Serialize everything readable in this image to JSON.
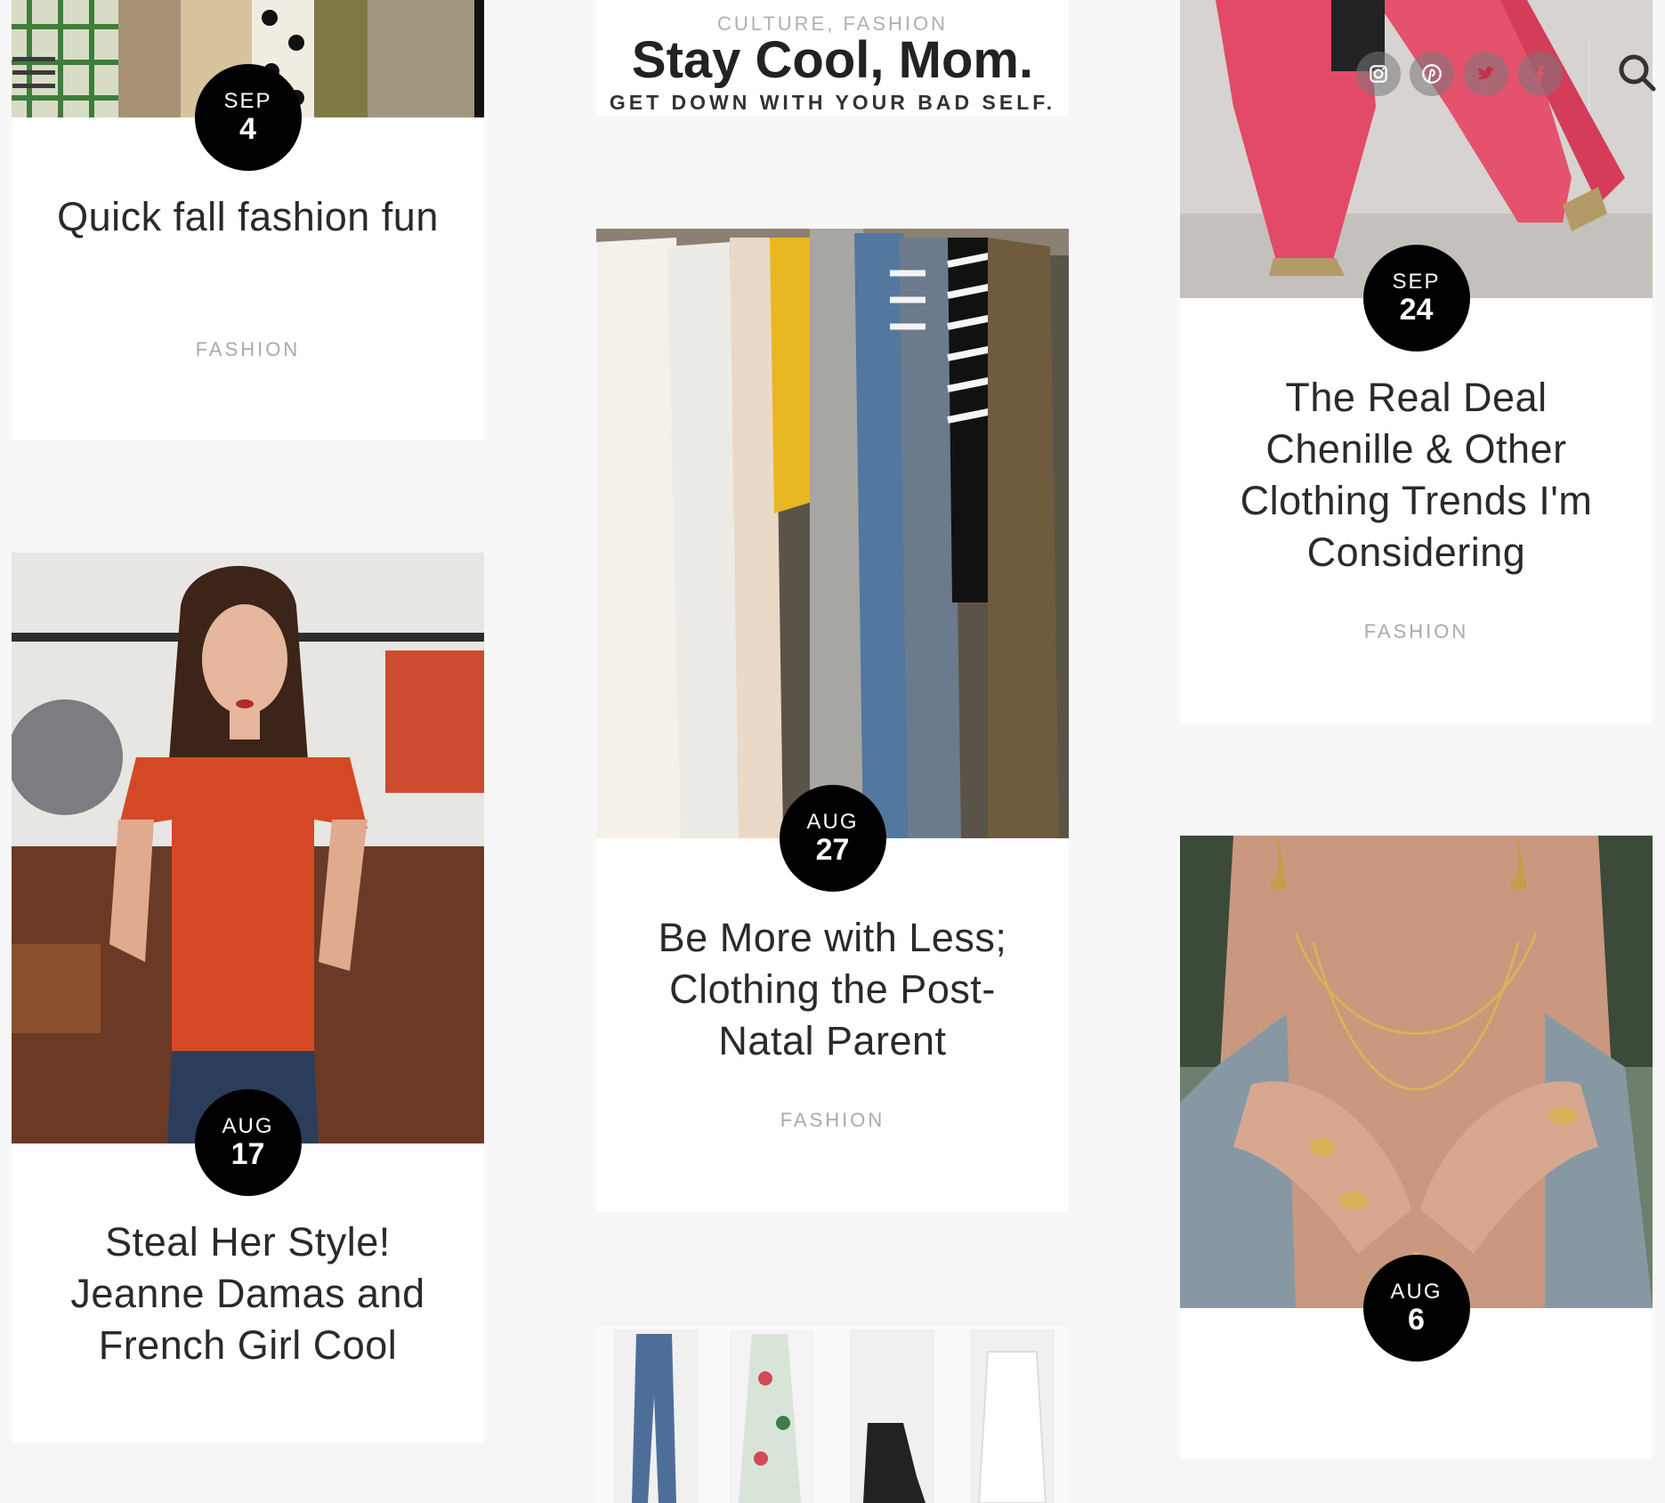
{
  "header": {
    "categories": "CULTURE, FASHION",
    "site_title": "Stay Cool, Mom.",
    "tagline": "GET DOWN WITH YOUR BAD SELF."
  },
  "social": [
    "instagram-icon",
    "pinterest-icon",
    "twitter-icon",
    "facebook-icon"
  ],
  "posts": [
    {
      "month": "SEP",
      "day": "4",
      "title": "Quick fall fashion fun",
      "category": "FASHION"
    },
    {
      "month": "SEP",
      "day": "24",
      "title": "The Real Deal Chenille & Other Clothing Trends I'm Considering",
      "category": "FASHION"
    },
    {
      "month": "AUG",
      "day": "27",
      "title": "Be More with Less; Clothing the Post-Natal Parent",
      "category": "FASHION"
    },
    {
      "month": "AUG",
      "day": "17",
      "title": "Steal Her Style! Jeanne Damas and French Girl Cool",
      "category": ""
    },
    {
      "month": "AUG",
      "day": "6",
      "title": "",
      "category": ""
    }
  ],
  "colors": {
    "accent": "#000000",
    "background": "#f7f7f7",
    "category_text": "#aaaaaa"
  }
}
